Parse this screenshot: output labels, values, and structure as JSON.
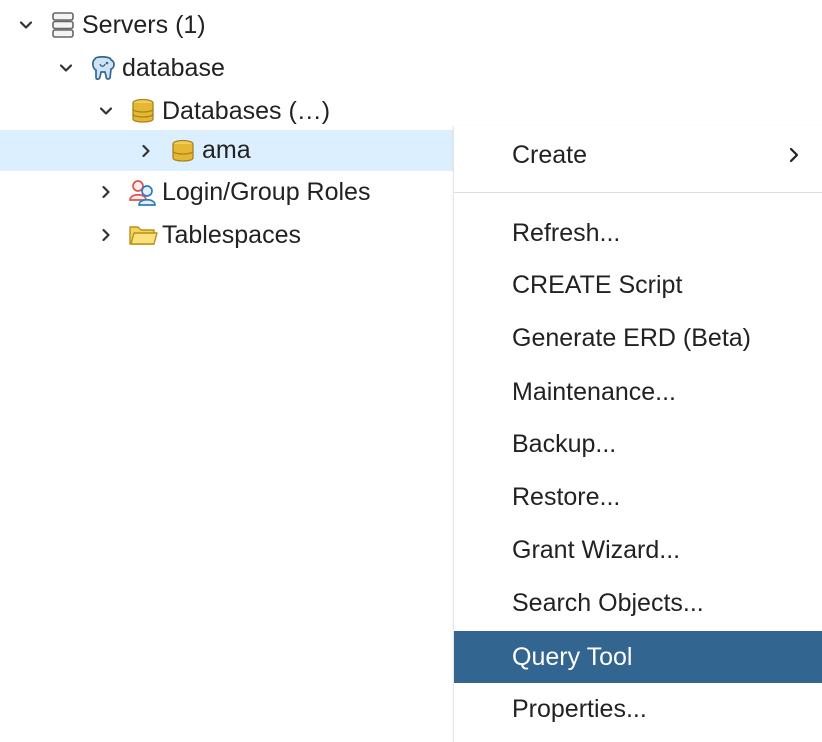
{
  "tree": {
    "servers": {
      "label": "Servers (1)",
      "icon": "servers-icon",
      "expanded": true
    },
    "server": {
      "label": "database",
      "icon": "postgres-elephant-icon",
      "expanded": true
    },
    "databases": {
      "label": "Databases (…)",
      "icon": "database-stack-icon",
      "expanded": true
    },
    "ama": {
      "label": "ama",
      "icon": "database-icon",
      "expanded": false,
      "selected": true
    },
    "login_roles": {
      "label": "Login/Group Roles",
      "icon": "users-icon",
      "expanded": false
    },
    "tablespaces": {
      "label": "Tablespaces",
      "icon": "folder-icon",
      "expanded": false
    }
  },
  "context_menu": {
    "items": [
      {
        "label": "Create",
        "has_submenu": true
      },
      {
        "label": "Refresh..."
      },
      {
        "label": "CREATE Script"
      },
      {
        "label": "Generate ERD (Beta)"
      },
      {
        "label": "Maintenance..."
      },
      {
        "label": "Backup..."
      },
      {
        "label": "Restore..."
      },
      {
        "label": "Grant Wizard..."
      },
      {
        "label": "Search Objects..."
      },
      {
        "label": "Query Tool",
        "highlighted": true
      },
      {
        "label": "Properties..."
      }
    ]
  },
  "colors": {
    "selection_bg": "#dcefff",
    "menu_highlight_bg": "#326690",
    "menu_highlight_text": "#ffffff",
    "text": "#222222"
  }
}
